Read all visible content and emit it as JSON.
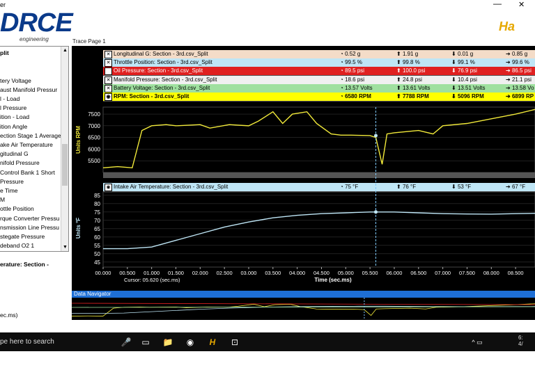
{
  "titlebar": {
    "title": "er",
    "min": "—",
    "close": "✕"
  },
  "logo": {
    "big": "DRCE",
    "sub": "engineering"
  },
  "brand_right": "Ha",
  "trace_page": "Trace Page 1",
  "left_list": [
    {
      "label": "plit",
      "bold": true
    },
    {
      "label": "",
      "bold": false
    },
    {
      "label": "",
      "bold": false
    },
    {
      "label": "tery Voltage",
      "bold": false
    },
    {
      "label": "aust Manifold Pressur",
      "bold": false
    },
    {
      "label": "l - Load",
      "bold": false
    },
    {
      "label": "l Pressure",
      "bold": false
    },
    {
      "label": "ition - Load",
      "bold": false
    },
    {
      "label": "ition Angle",
      "bold": false
    },
    {
      "label": "ection Stage 1 Average",
      "bold": false
    },
    {
      "label": "ake Air Temperature",
      "bold": false
    },
    {
      "label": "gitudinal G",
      "bold": false
    },
    {
      "label": "nifold Pressure",
      "bold": false
    },
    {
      "label": "Control Bank 1 Short",
      "bold": false
    },
    {
      "label": "Pressure",
      "bold": false
    },
    {
      "label": "e Time",
      "bold": false
    },
    {
      "label": "M",
      "bold": false
    },
    {
      "label": "ottle Position",
      "bold": false
    },
    {
      "label": "rque Converter Pressu",
      "bold": false
    },
    {
      "label": "nsmission Line Pressu",
      "bold": false
    },
    {
      "label": "stegate Pressure",
      "bold": false
    },
    {
      "label": "deband O2 1",
      "bold": false
    }
  ],
  "selected_label": "erature: Section -",
  "left_cursor": "ec.ms)",
  "legend": [
    {
      "name": "Longitudinal G: Section - 3rd.csv_Split",
      "cur": "0.52 g",
      "max": "1.91 g",
      "min": "0.01 g",
      "last": "0.85 g",
      "bg": "#f4dcc8",
      "fg": "#000"
    },
    {
      "name": "Throttle Position: Section - 3rd.csv_Split",
      "cur": "99.5 %",
      "max": "99.8 %",
      "min": "99.1 %",
      "last": "99.6 %",
      "bg": "#bfe6f6",
      "fg": "#000"
    },
    {
      "name": "Oil Pressure: Section - 3rd.csv_Split",
      "cur": "89.5 psi",
      "max": "100.0 psi",
      "min": "76.9 psi",
      "last": "86.5 psi",
      "bg": "#e02020",
      "fg": "#fff"
    },
    {
      "name": "Manifold Pressure: Section - 3rd.csv_Split",
      "cur": "18.6 psi",
      "max": "24.8 psi",
      "min": "10.4 psi",
      "last": "21.1 psi",
      "bg": "#f0f0f0",
      "fg": "#000"
    },
    {
      "name": "Battery Voltage: Section - 3rd.csv_Split",
      "cur": "13.57 Volts",
      "max": "13.61 Volts",
      "min": "13.51 Volts",
      "last": "13.58 Vo",
      "bg": "#9fe09f",
      "fg": "#000"
    },
    {
      "name": "RPM: Section - 3rd.csv_Split",
      "cur": "6580 RPM",
      "max": "7788 RPM",
      "min": "5096 RPM",
      "last": "6899 RP",
      "bg": "#ffff00",
      "fg": "#000"
    }
  ],
  "rpm_chart": {
    "ylabel": "Units RPM",
    "yticks": [
      "7500",
      "7000",
      "6500",
      "6000",
      "5500"
    ]
  },
  "iat_legend": {
    "name": "Intake Air Temperature: Section - 3rd.csv_Split",
    "cur": "75 °F",
    "max": "76 °F",
    "min": "53 °F",
    "last": "67 °F"
  },
  "iat_chart": {
    "ylabel": "Units °F",
    "yticks": [
      "85",
      "80",
      "75",
      "70",
      "65",
      "60",
      "55",
      "50",
      "45"
    ]
  },
  "x_axis": {
    "ticks": [
      "00.000",
      "00.500",
      "01.000",
      "01.500",
      "02.000",
      "02.500",
      "03.000",
      "03.500",
      "04.000",
      "04.500",
      "05.000",
      "05.500",
      "06.000",
      "06.500",
      "07.000",
      "07.500",
      "08.000",
      "08.500"
    ],
    "title": "Time (sec.ms)",
    "cursor": "Cursor: 05.620 (sec.ms)"
  },
  "navigator": "Data Navigator",
  "taskbar": {
    "search": "pe here to search",
    "clock": "6:\n4/"
  },
  "colors": {
    "rpm": "#f2ea3a",
    "iat": "#bfe6f6",
    "cursor": "#7ec8ff"
  },
  "chart_data": {
    "type": "line",
    "series": [
      {
        "name": "RPM: Section - 3rd.csv_Split",
        "x": [
          0,
          0.3,
          0.6,
          0.8,
          1.0,
          1.3,
          1.5,
          2.0,
          2.2,
          2.6,
          3.0,
          3.2,
          3.5,
          3.7,
          3.9,
          4.2,
          4.4,
          4.7,
          4.9,
          5.1,
          5.5,
          5.62,
          5.75,
          5.85,
          6.0,
          6.5,
          6.8,
          7.0,
          7.5,
          8.0,
          8.5,
          8.9
        ],
        "y": [
          5200,
          5250,
          5200,
          6800,
          7000,
          7050,
          7000,
          7050,
          6900,
          7050,
          7000,
          7200,
          7600,
          7100,
          7500,
          7600,
          7100,
          6650,
          6600,
          6600,
          6580,
          6500,
          5350,
          6650,
          6700,
          6800,
          6650,
          7000,
          7100,
          7300,
          7500,
          7700
        ]
      },
      {
        "name": "Intake Air Temperature: Section - 3rd.csv_Split",
        "x": [
          0,
          0.5,
          1.0,
          1.5,
          2.0,
          2.5,
          3.0,
          3.5,
          4.0,
          4.5,
          5.0,
          5.5,
          5.62,
          6.0,
          6.5,
          7.0,
          7.5,
          8.0,
          8.5,
          8.9
        ],
        "y": [
          53,
          53,
          54,
          58,
          62,
          66,
          69,
          71.5,
          73,
          74,
          74.5,
          75,
          75,
          75,
          74.5,
          74,
          73.8,
          73.7,
          74,
          74.2
        ]
      }
    ],
    "xlim": [
      0,
      8.9
    ],
    "rpm_ylim": [
      5000,
      7800
    ],
    "iat_ylim": [
      42,
      87
    ],
    "cursor_x": 5.62
  }
}
